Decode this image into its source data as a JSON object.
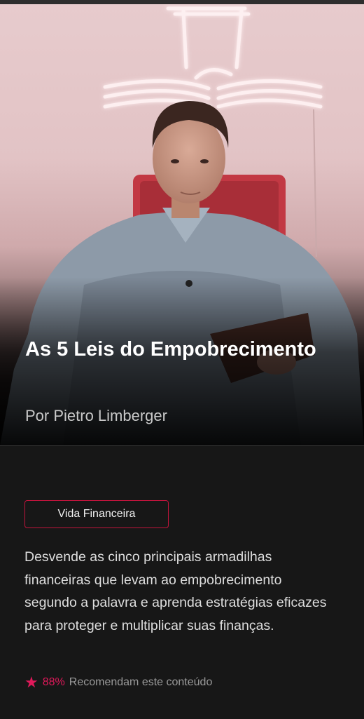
{
  "hero": {
    "title": "As 5 Leis do Empobrecimento",
    "author": "Por Pietro Limberger"
  },
  "content": {
    "category_tag": "Vida Financeira",
    "description": "Desvende as cinco principais armadilhas financeiras que levam ao empobrecimento segundo a palavra e aprenda estratégias eficazes para proteger e multiplicar suas finanças.",
    "recommendation": {
      "icon": "star-icon",
      "percent": "88%",
      "label": "Recomendam este conteúdo"
    }
  },
  "colors": {
    "accent": "#e0195a",
    "background": "#171717",
    "neon": "#ffd5d8"
  }
}
